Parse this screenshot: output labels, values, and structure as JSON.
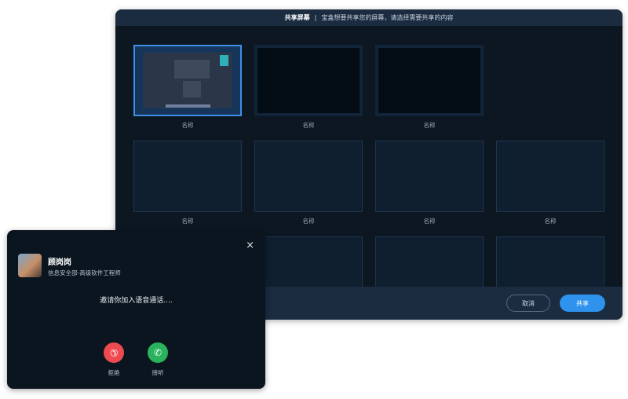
{
  "share_window": {
    "title": "共享屏幕",
    "separator": "|",
    "subtitle": "宝盒想要共享您的屏幕，请选择需要共享的内容",
    "tiles": [
      {
        "label": "名称",
        "selected": true
      },
      {
        "label": "名称"
      },
      {
        "label": "名称"
      },
      {
        "label": "名称"
      },
      {
        "label": "名称"
      },
      {
        "label": "名称"
      },
      {
        "label": "名称"
      }
    ],
    "cancel_label": "取消",
    "share_label": "共享"
  },
  "call_popup": {
    "caller_name": "顾岗岗",
    "caller_title": "信息安全部-高级软件工程师",
    "message": "邀请你加入语音通话....",
    "close_icon": "×",
    "reject_label": "拒绝",
    "accept_label": "接听"
  },
  "colors": {
    "accent": "#2f93ee",
    "reject": "#ef4a4f",
    "accept": "#29b35d"
  }
}
